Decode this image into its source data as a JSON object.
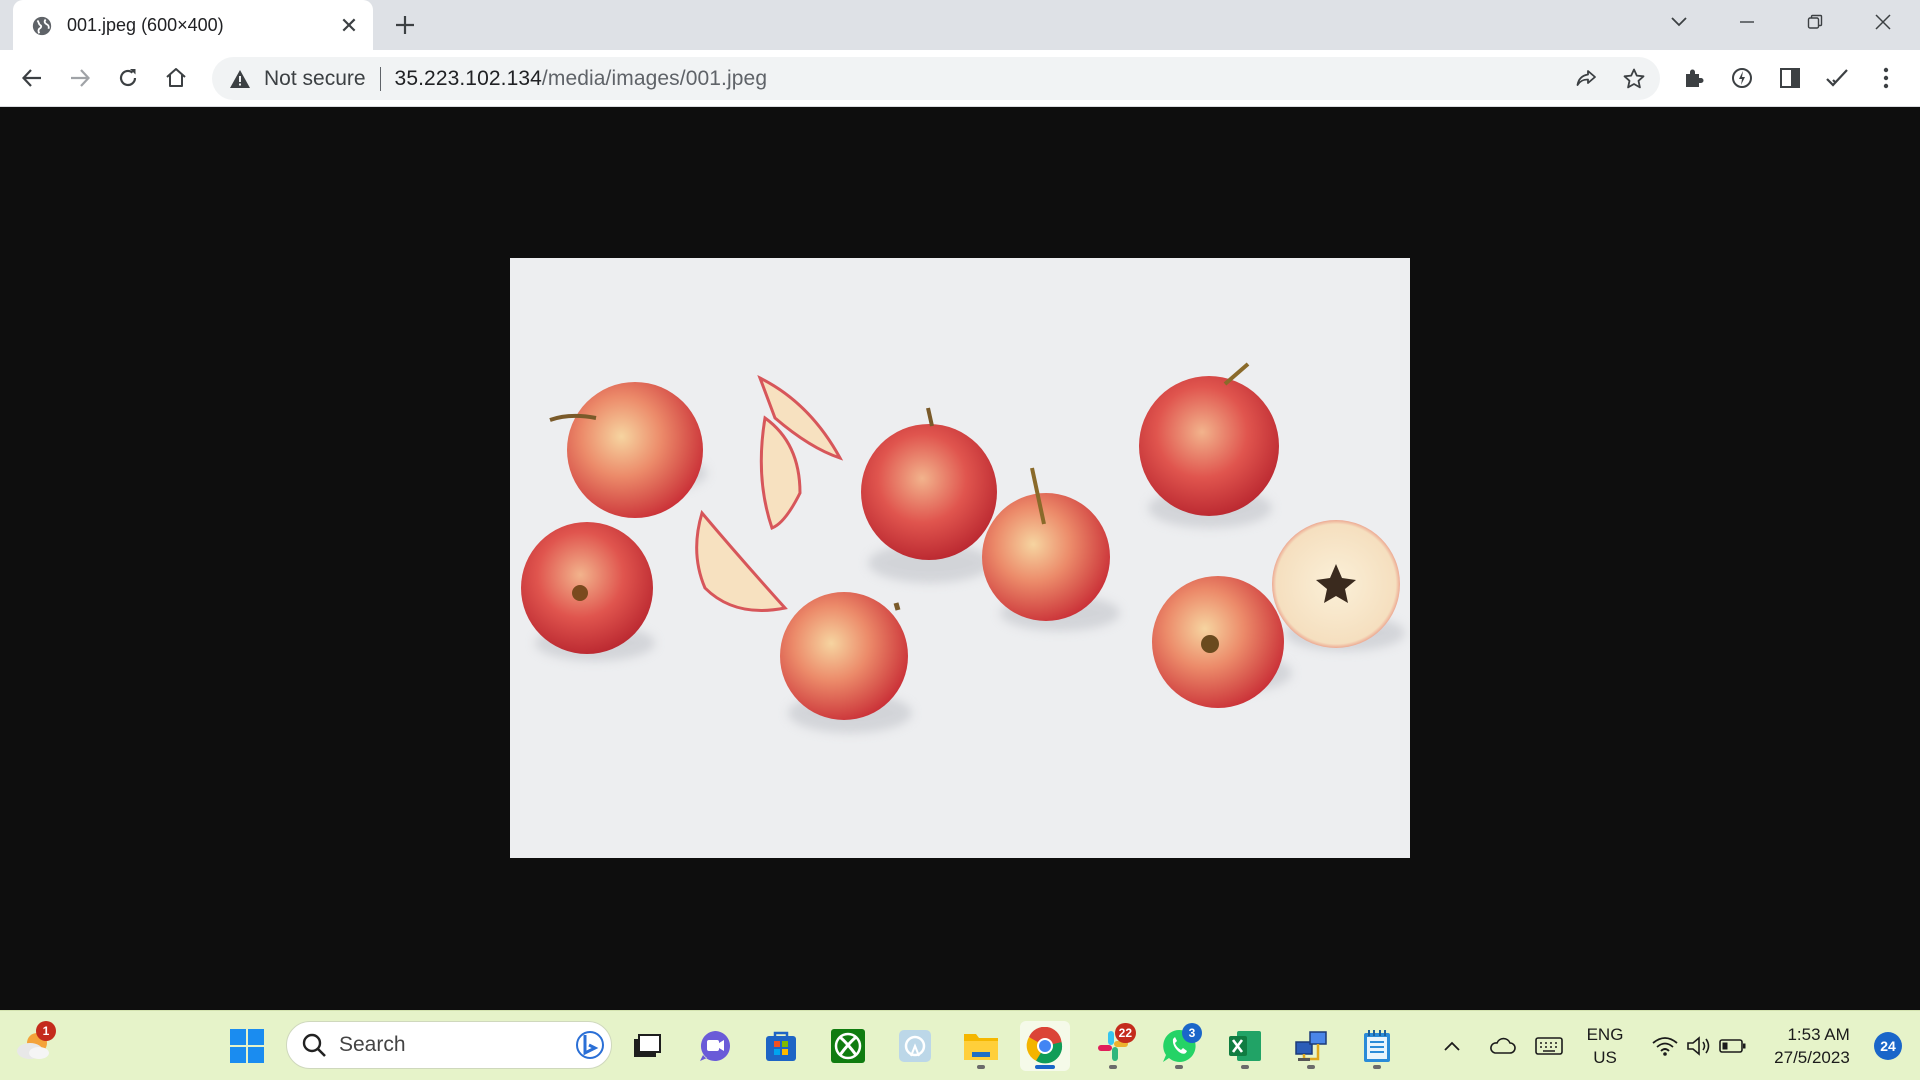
{
  "browser": {
    "tab_title": "001.jpeg (600×400)",
    "omnibox": {
      "security_label": "Not secure",
      "url_host": "35.223.102.134",
      "url_path": "/media/images/001.jpeg"
    }
  },
  "image": {
    "background_color": "#e9ebed",
    "apple_colors": [
      "#d9343b",
      "#f0a872",
      "#f6e2b8"
    ]
  },
  "taskbar": {
    "widgets_badge": "1",
    "search_label": "Search",
    "apps": [
      {
        "name": "start-menu"
      },
      {
        "name": "task-view"
      },
      {
        "name": "teams-chat"
      },
      {
        "name": "microsoft-store"
      },
      {
        "name": "xbox"
      },
      {
        "name": "app-generic"
      },
      {
        "name": "file-explorer"
      },
      {
        "name": "chrome"
      },
      {
        "name": "slack",
        "badge": "22"
      },
      {
        "name": "whatsapp",
        "badge": "3"
      },
      {
        "name": "excel"
      },
      {
        "name": "network-app"
      },
      {
        "name": "notepad"
      }
    ],
    "tray": {
      "lang_line1": "ENG",
      "lang_line2": "US",
      "time": "1:53 AM",
      "date": "27/5/2023",
      "notification_count": "24"
    }
  }
}
